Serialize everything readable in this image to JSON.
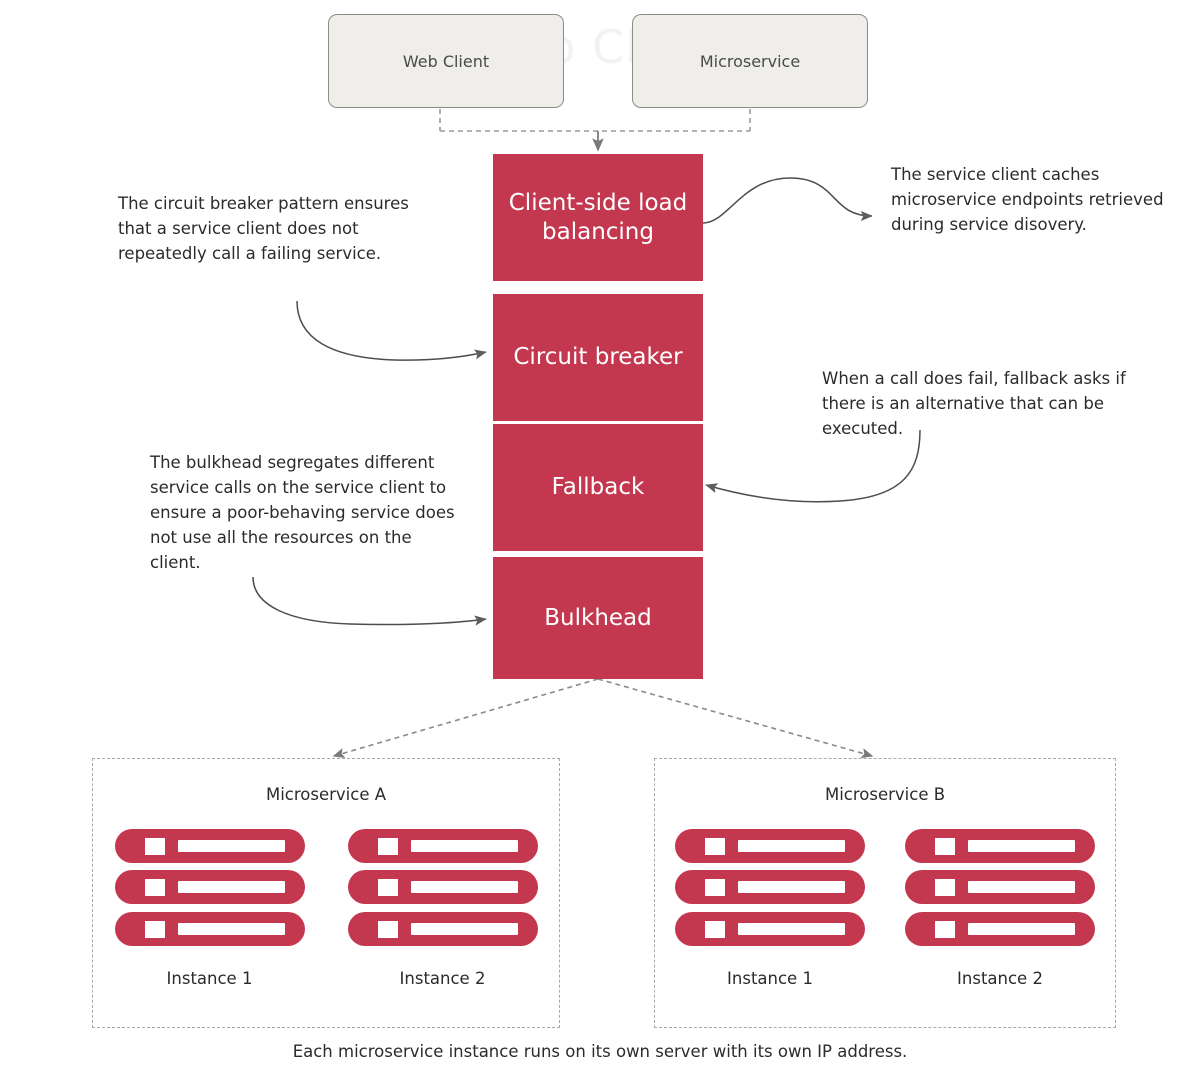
{
  "diagram": {
    "ghost_title": "o Cli",
    "caption": "Each microservice instance runs on its own server with its own IP address.",
    "colors": {
      "pattern_box_red": "#c4384f",
      "client_box_fill": "#efeeea",
      "client_box_border": "#8c8c84",
      "connector_gray": "#7a7a7a",
      "dashed_border": "#a8a8a8",
      "text_dark": "#2b2b2b"
    }
  },
  "clients": [
    {
      "id": "web-client",
      "label": "Web Client"
    },
    {
      "id": "microservice-client",
      "label": "Microservice"
    }
  ],
  "patterns": [
    {
      "id": "client-side-load-balancing",
      "label": "Client-side load balancing"
    },
    {
      "id": "circuit-breaker",
      "label": "Circuit breaker"
    },
    {
      "id": "fallback",
      "label": "Fallback"
    },
    {
      "id": "bulkhead",
      "label": "Bulkhead"
    }
  ],
  "annotations": {
    "load_balancing": "The service client caches microservice endpoints retrieved during service disovery.",
    "circuit_breaker": "The circuit breaker pattern ensures that a service client does not repeatedly call a failing service.",
    "fallback": "When a call does fail, fallback asks if there is an alternative that can be executed.",
    "bulkhead": "The bulkhead segregates different service calls on the service client to ensure a poor-behaving service does not use all the resources on the client."
  },
  "microservice_groups": [
    {
      "id": "microservice-a",
      "title": "Microservice A",
      "instances": [
        {
          "label": "Instance 1"
        },
        {
          "label": "Instance 2"
        }
      ]
    },
    {
      "id": "microservice-b",
      "title": "Microservice B",
      "instances": [
        {
          "label": "Instance 1"
        },
        {
          "label": "Instance 2"
        }
      ]
    }
  ]
}
